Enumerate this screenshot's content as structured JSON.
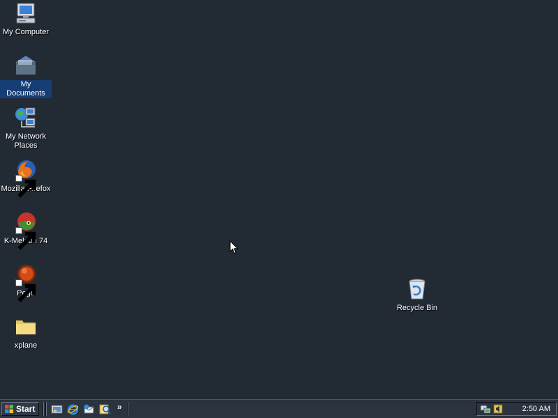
{
  "desktop": {
    "icons": [
      {
        "label": "My Computer",
        "icon": "computer-icon",
        "shortcut": false,
        "selected": false
      },
      {
        "label": "My Documents",
        "icon": "documents-folder-icon",
        "shortcut": false,
        "selected": true
      },
      {
        "label": "My Network Places",
        "icon": "network-places-icon",
        "shortcut": false,
        "selected": false
      },
      {
        "label": "Mozilla Firefox",
        "icon": "firefox-icon",
        "shortcut": true,
        "selected": false
      },
      {
        "label": "K-Meleon 74",
        "icon": "k-meleon-icon",
        "shortcut": true,
        "selected": false
      },
      {
        "label": "Pego",
        "icon": "pego-icon",
        "shortcut": true,
        "selected": false
      },
      {
        "label": "xplane",
        "icon": "folder-icon",
        "shortcut": false,
        "selected": false
      }
    ],
    "recycle_bin": {
      "label": "Recycle Bin",
      "icon": "recycle-bin-icon"
    }
  },
  "taskbar": {
    "start_label": "Start",
    "quick_launch": [
      "show-desktop-icon",
      "internet-explorer-icon",
      "outlook-express-icon",
      "search-icon"
    ],
    "quick_launch_more": "»",
    "tray_icons": [
      "network-tray-icon",
      "volume-tray-icon"
    ],
    "clock": "2:50 AM"
  },
  "colors": {
    "desktop_background": "#222a34",
    "selection": "#163e74",
    "taskbar": "#2a333e"
  }
}
